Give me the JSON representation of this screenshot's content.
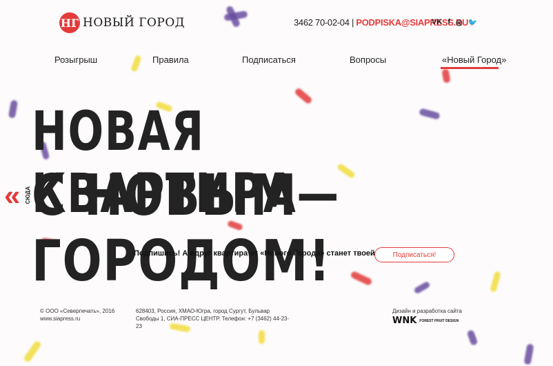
{
  "brand": {
    "logo_letters": "НГ",
    "name": "НОВЫЙ ГОРОД"
  },
  "header": {
    "phone": "3462 70-02-04",
    "separator": "|",
    "email": "PODPISKA@SIAPRESS.RU",
    "social": [
      "vk-icon",
      "facebook-icon",
      "instagram-icon",
      "twitter-icon"
    ],
    "social_glyphs": [
      "VK",
      "f",
      "◎",
      "🐦"
    ]
  },
  "nav": {
    "items": [
      "Розыгрыш",
      "Правила",
      "Подписаться",
      "Вопросы",
      "«Новый Город»"
    ],
    "active": "«Новый Город»"
  },
  "hero": {
    "line1": "Новая квартира—",
    "line2": "с Новым Городом!",
    "side_label": "СЮДА",
    "tagline": "Подпишись! А вдруг квартира от «Нового Города» станет твоей?",
    "cta": "Подписаться!"
  },
  "footer": {
    "copyright": "© ООО «Северпечать», 2016",
    "site": "www.siapress.ru",
    "address": "628403, Россия, ХМАО-Югра, город Сургут, Бульвар Свободы 1, СИА-ПРЕСС ЦЕНТР. Телефон: +7 (3462) 44-23-23",
    "design_label": "Дизайн и разработка сайта",
    "studio_logo": "WNK",
    "studio_partner": "FOREST FRUIT DESIGN"
  },
  "colors": {
    "accent": "#e33b3b",
    "text": "#232323",
    "background": "#fdfbfb"
  }
}
